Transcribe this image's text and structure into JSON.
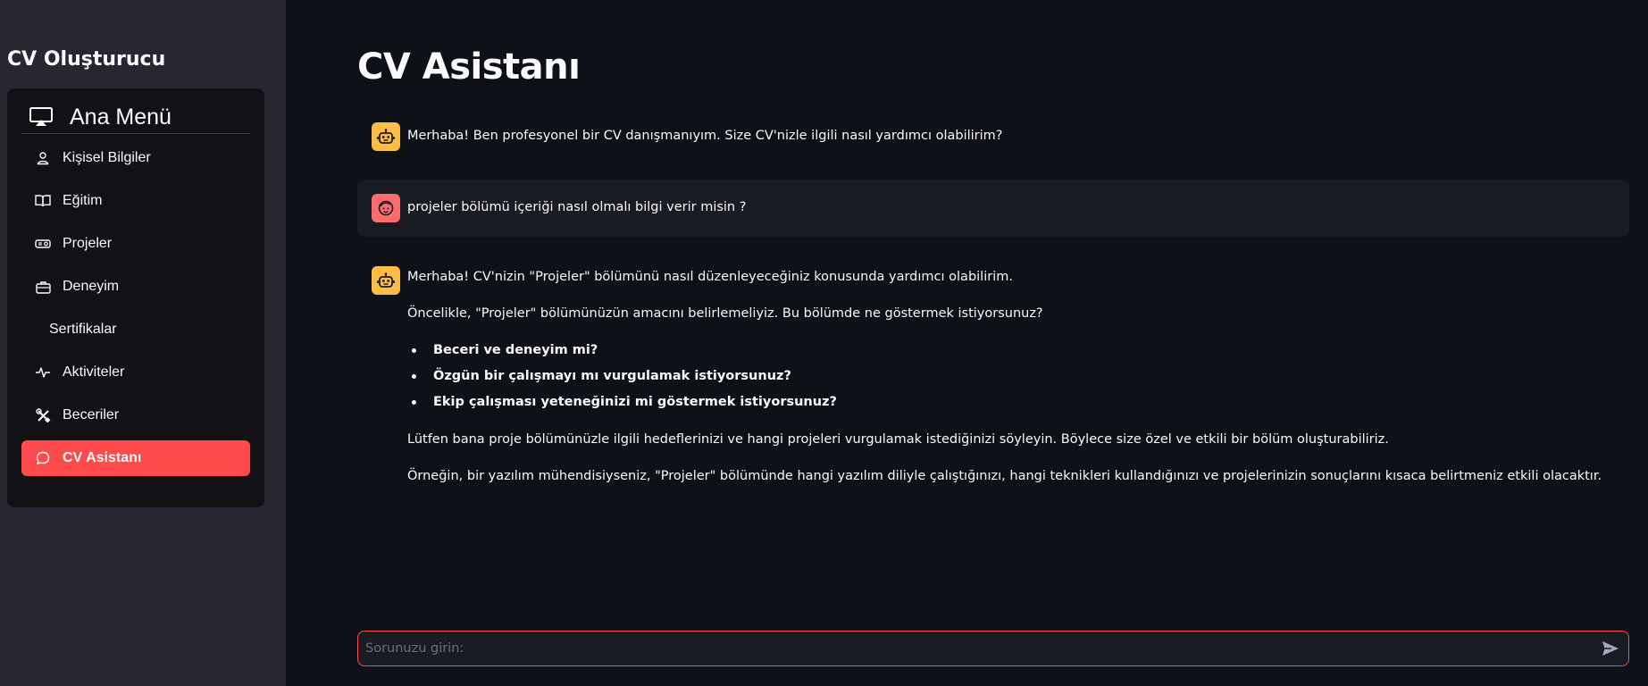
{
  "sidebar": {
    "title": "CV Oluşturucu",
    "menu_title": "Ana Menü",
    "items": [
      {
        "label": "Kişisel Bilgiler",
        "icon": "person-icon",
        "active": false
      },
      {
        "label": "Eğitim",
        "icon": "book-icon",
        "active": false
      },
      {
        "label": "Projeler",
        "icon": "projector-icon",
        "active": false
      },
      {
        "label": "Deneyim",
        "icon": "briefcase-icon",
        "active": false
      },
      {
        "label": "Sertifikalar",
        "icon": "",
        "active": false
      },
      {
        "label": "Aktiviteler",
        "icon": "activity-icon",
        "active": false
      },
      {
        "label": "Beceriler",
        "icon": "tools-icon",
        "active": false
      },
      {
        "label": "CV Asistanı",
        "icon": "chat-icon",
        "active": true
      }
    ]
  },
  "main": {
    "title": "CV Asistanı",
    "messages": [
      {
        "role": "assistant",
        "text": "Merhaba! Ben profesyonel bir CV danışmanıyım. Size CV'nizle ilgili nasıl yardımcı olabilirim?"
      },
      {
        "role": "user",
        "text": "projeler bölümü içeriği nasıl olmalı bilgi verir misin ?"
      },
      {
        "role": "assistant",
        "intro": "Merhaba! CV'nizin \"Projeler\" bölümünü nasıl düzenleyeceğiniz konusunda yardımcı olabilirim.",
        "p1": "Öncelikle, \"Projeler\" bölümünüzün amacını belirlemeliyiz. Bu bölümde ne göstermek istiyorsunuz?",
        "bullets": [
          "Beceri ve deneyim mi?",
          "Özgün bir çalışmayı mı vurgulamak istiyorsunuz?",
          "Ekip çalışması yeteneğinizi mi göstermek istiyorsunuz?"
        ],
        "p2": "Lütfen bana proje bölümünüzle ilgili hedeflerinizi ve hangi projeleri vurgulamak istediğinizi söyleyin. Böylece size özel ve etkili bir bölüm oluşturabiliriz.",
        "p3": "Örneğin, bir yazılım mühendisiyseniz, \"Projeler\" bölümünde hangi yazılım diliyle çalıştığınızı, hangi teknikleri kullandığınızı ve projelerinizin sonuçlarını kısaca belirtmeniz etkili olacaktır."
      }
    ],
    "input": {
      "placeholder": "Sorunuzu girin:",
      "value": ""
    }
  },
  "colors": {
    "accent": "#ff4b4b",
    "bot_avatar": "#ffbd45",
    "user_avatar": "#ff6c6c",
    "background": "#0e1117",
    "sidebar": "#262730"
  }
}
